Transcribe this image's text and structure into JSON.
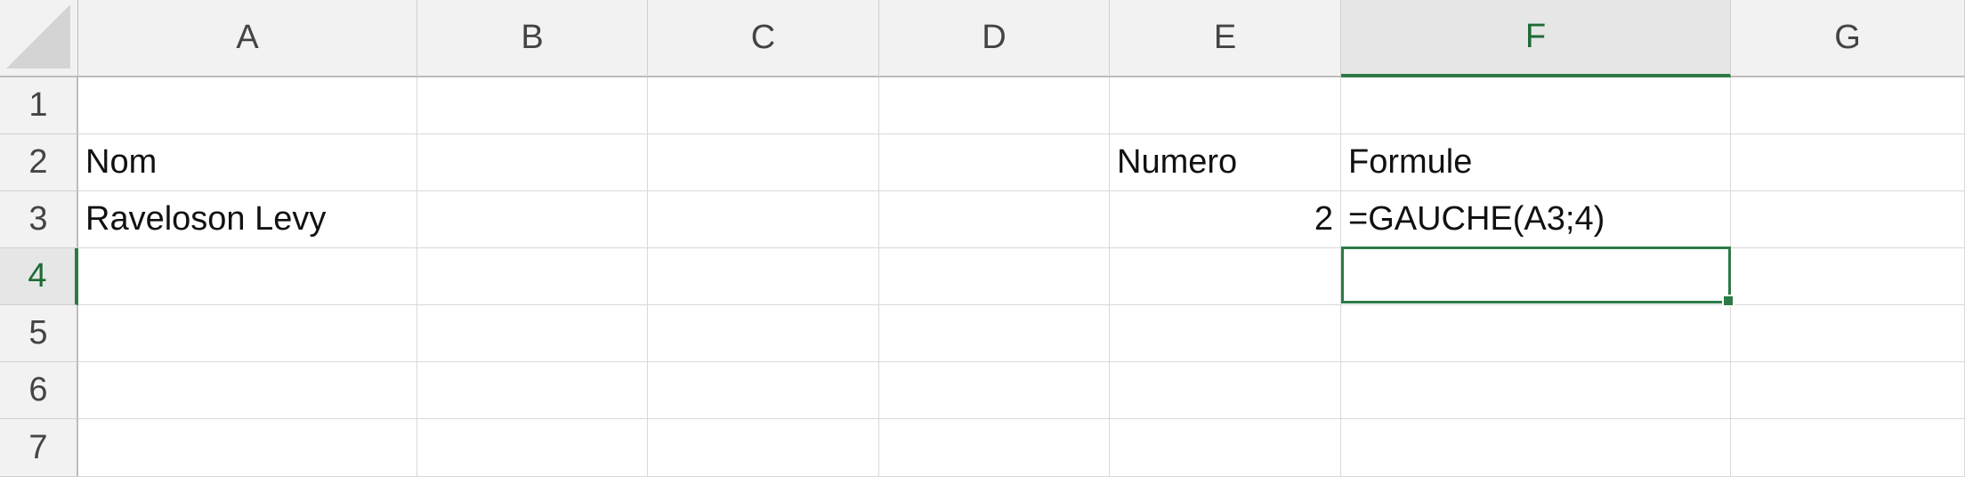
{
  "columns": [
    "A",
    "B",
    "C",
    "D",
    "E",
    "F",
    "G"
  ],
  "rows": [
    "1",
    "2",
    "3",
    "4",
    "5",
    "6",
    "7"
  ],
  "active_column": "F",
  "active_row": "4",
  "selected_cell": "F4",
  "accent_color": "#2d7a46",
  "cells": {
    "A2": "Nom",
    "A3": "Raveloson Levy",
    "E2": "Numero",
    "E3": "2",
    "F2": "Formule",
    "F3": "=GAUCHE(A3;4)"
  }
}
